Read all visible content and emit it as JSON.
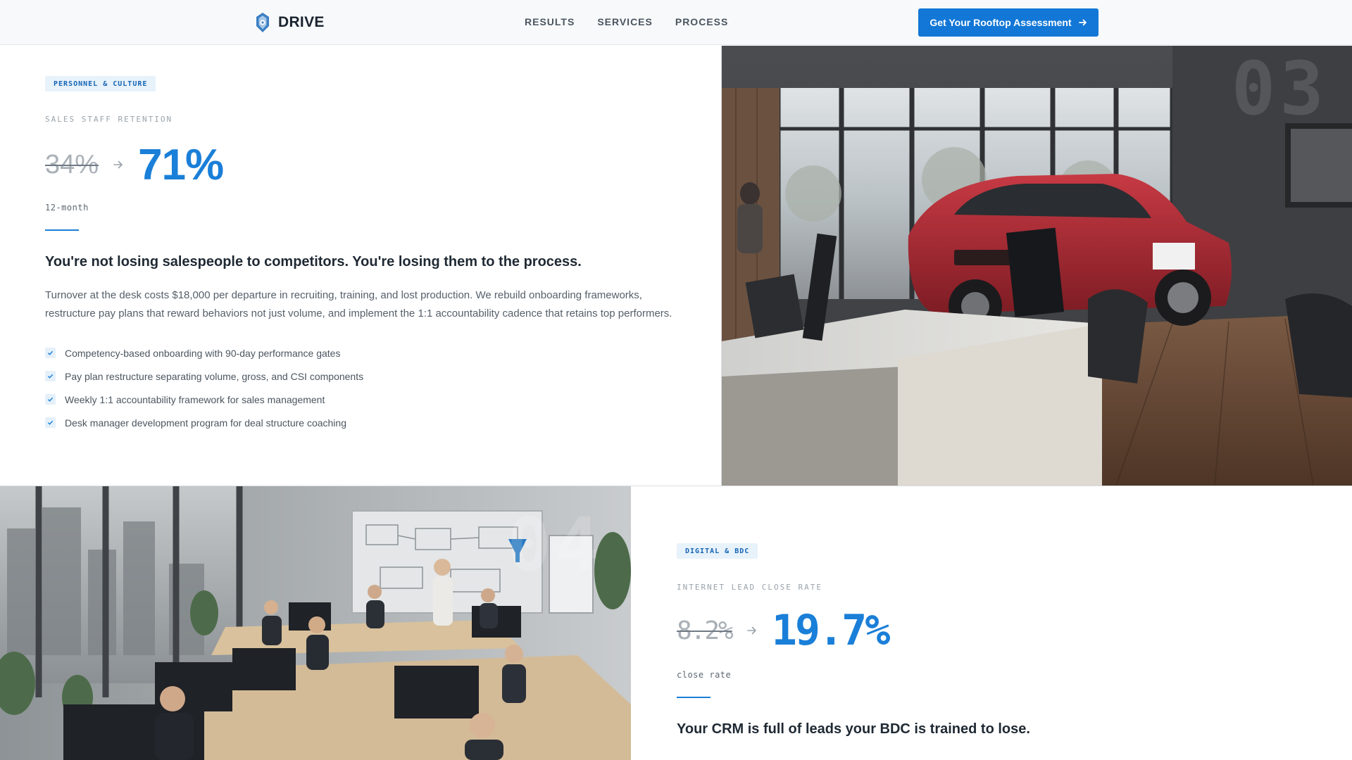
{
  "header": {
    "brand": "DRIVE",
    "nav": [
      "RESULTS",
      "SERVICES",
      "PROCESS"
    ],
    "cta_label": "Get Your Rooftop Assessment"
  },
  "section1": {
    "badge": "PERSONNEL & CULTURE",
    "eyebrow": "SALES STAFF RETENTION",
    "stat_before": "34%",
    "stat_after": "71%",
    "unit": "12-month",
    "headline": "You're not losing salespeople to competitors. You're losing them to the process.",
    "body": "Turnover at the desk costs $18,000 per departure in recruiting, training, and lost production. We rebuild onboarding frameworks, restructure pay plans that reward behaviors not just volume, and implement the 1:1 accountability cadence that retains top performers.",
    "checklist": [
      "Competency-based onboarding with 90-day performance gates",
      "Pay plan restructure separating volume, gross, and CSI components",
      "Weekly 1:1 accountability framework for sales management",
      "Desk manager development program for deal structure coaching"
    ],
    "image_number": "03"
  },
  "section2": {
    "badge": "DIGITAL & BDC",
    "eyebrow": "INTERNET LEAD CLOSE RATE",
    "stat_before": "8.2%",
    "stat_after": "19.7%",
    "unit": "close rate",
    "headline": "Your CRM is full of leads your BDC is trained to lose.",
    "image_number": "04"
  },
  "colors": {
    "accent": "#1a7fd8",
    "cta": "#1277d6",
    "badge_bg": "#e8f2fb",
    "badge_text": "#1465b5"
  },
  "icons": {
    "logo": "drive-logo-icon",
    "cta_arrow": "arrow-right-icon",
    "stat_arrow": "arrow-right-icon",
    "check": "check-icon"
  }
}
